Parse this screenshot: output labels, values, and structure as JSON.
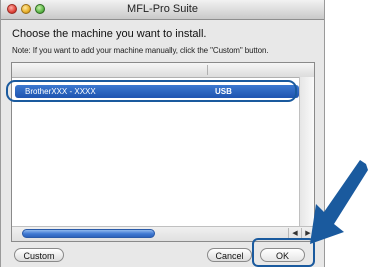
{
  "window": {
    "title": "MFL-Pro Suite"
  },
  "dialog": {
    "heading": "Choose the machine you want to install.",
    "note": "Note: If you want to add your machine manually, click the \"Custom\" button."
  },
  "machine_list": {
    "rows": [
      {
        "name": "BrotherXXX - XXXX",
        "connection": "USB",
        "selected": true
      }
    ]
  },
  "buttons": {
    "custom": "Custom",
    "cancel": "Cancel",
    "ok": "OK"
  },
  "colors": {
    "selection": "#2f66c4",
    "callout": "#1a5a9e"
  }
}
